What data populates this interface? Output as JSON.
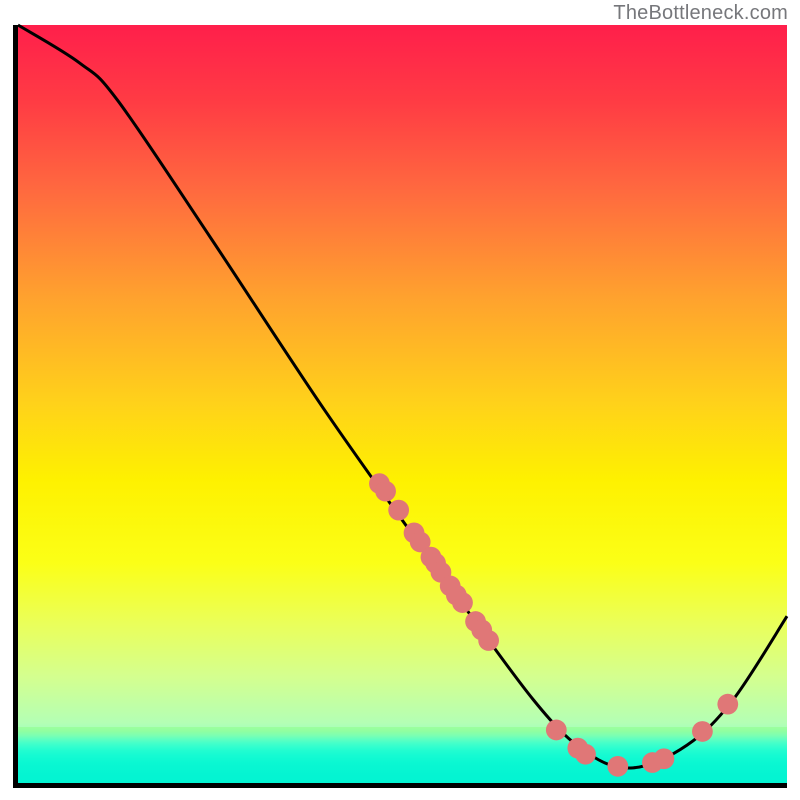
{
  "watermark": "TheBottleneck.com",
  "chart_data": {
    "type": "line",
    "title": "",
    "xlabel": "",
    "ylabel": "",
    "xlim": [
      0,
      100
    ],
    "ylim": [
      0,
      100
    ],
    "curve": [
      {
        "x": 0,
        "y": 100
      },
      {
        "x": 8,
        "y": 95
      },
      {
        "x": 13,
        "y": 90
      },
      {
        "x": 25,
        "y": 72
      },
      {
        "x": 40,
        "y": 49
      },
      {
        "x": 54,
        "y": 29
      },
      {
        "x": 67,
        "y": 11
      },
      {
        "x": 74,
        "y": 4
      },
      {
        "x": 80,
        "y": 2
      },
      {
        "x": 87,
        "y": 5
      },
      {
        "x": 93,
        "y": 11
      },
      {
        "x": 100,
        "y": 22
      }
    ],
    "points": [
      {
        "x": 47.0,
        "y": 39.5
      },
      {
        "x": 47.8,
        "y": 38.5
      },
      {
        "x": 49.5,
        "y": 36.0
      },
      {
        "x": 51.5,
        "y": 33.0
      },
      {
        "x": 52.3,
        "y": 31.8
      },
      {
        "x": 53.7,
        "y": 29.8
      },
      {
        "x": 54.3,
        "y": 29.0
      },
      {
        "x": 55.0,
        "y": 27.8
      },
      {
        "x": 56.2,
        "y": 26.0
      },
      {
        "x": 57.0,
        "y": 24.8
      },
      {
        "x": 57.8,
        "y": 23.8
      },
      {
        "x": 59.5,
        "y": 21.3
      },
      {
        "x": 60.3,
        "y": 20.2
      },
      {
        "x": 61.2,
        "y": 18.8
      },
      {
        "x": 70.0,
        "y": 7.0
      },
      {
        "x": 72.8,
        "y": 4.6
      },
      {
        "x": 73.8,
        "y": 3.8
      },
      {
        "x": 78.0,
        "y": 2.2
      },
      {
        "x": 82.5,
        "y": 2.7
      },
      {
        "x": 84.0,
        "y": 3.2
      },
      {
        "x": 89.0,
        "y": 6.8
      },
      {
        "x": 92.3,
        "y": 10.4
      }
    ],
    "point_color": "#e07777",
    "curve_color": "#000000"
  }
}
